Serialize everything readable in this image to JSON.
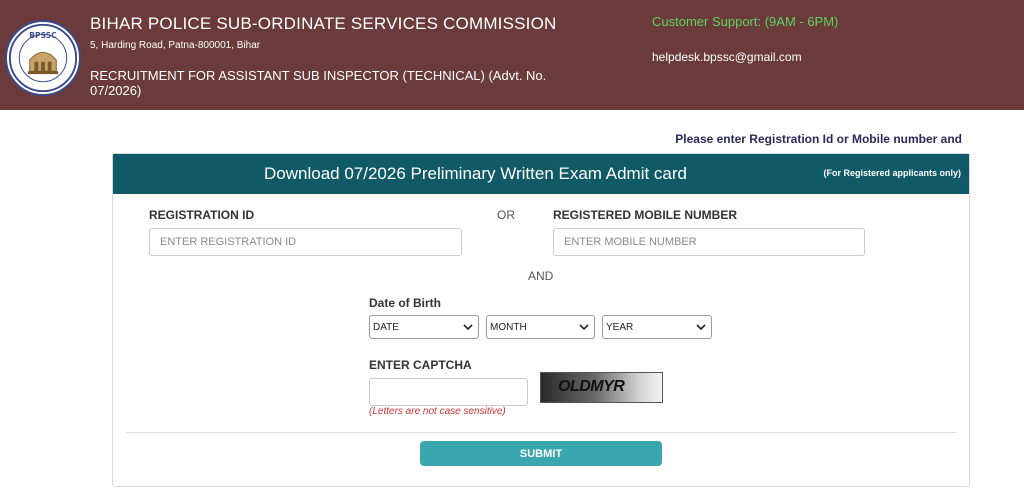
{
  "header": {
    "logo_text": "BPSSC",
    "org_name": "BIHAR POLICE SUB-ORDINATE SERVICES COMMISSION",
    "address": "5, Harding Road, Patna-800001, Bihar",
    "recruitment": "RECRUITMENT FOR ASSISTANT SUB INSPECTOR (TECHNICAL) (Advt. No. 07/2026)",
    "support": "Customer Support: (9AM - 6PM)",
    "email": "helpdesk.bpssc@gmail.com"
  },
  "notice": "Please enter Registration Id or Mobile number and",
  "card": {
    "title": "Download 07/2026 Preliminary Written Exam Admit card",
    "note": "(For Registered applicants only)"
  },
  "form": {
    "reg_label": "REGISTRATION ID",
    "reg_placeholder": "ENTER REGISTRATION ID",
    "or_text": "OR",
    "mobile_label": "REGISTERED MOBILE NUMBER",
    "mobile_placeholder": "ENTER MOBILE NUMBER",
    "and_text": "AND",
    "dob_label": "Date of Birth",
    "date_value": "DATE",
    "month_value": "MONTH",
    "year_value": "YEAR",
    "captcha_label": "ENTER CAPTCHA",
    "captcha_text": "OLDMYR",
    "captcha_hint": "(Letters are not case sensitive)",
    "submit_label": "SUBMIT"
  },
  "colors": {
    "header_bg": "#6b3a3a",
    "card_header_bg": "#0f5a66",
    "support_green": "#5fd35f",
    "submit_bg": "#3aa6ae",
    "hint_red": "#cc3333"
  }
}
